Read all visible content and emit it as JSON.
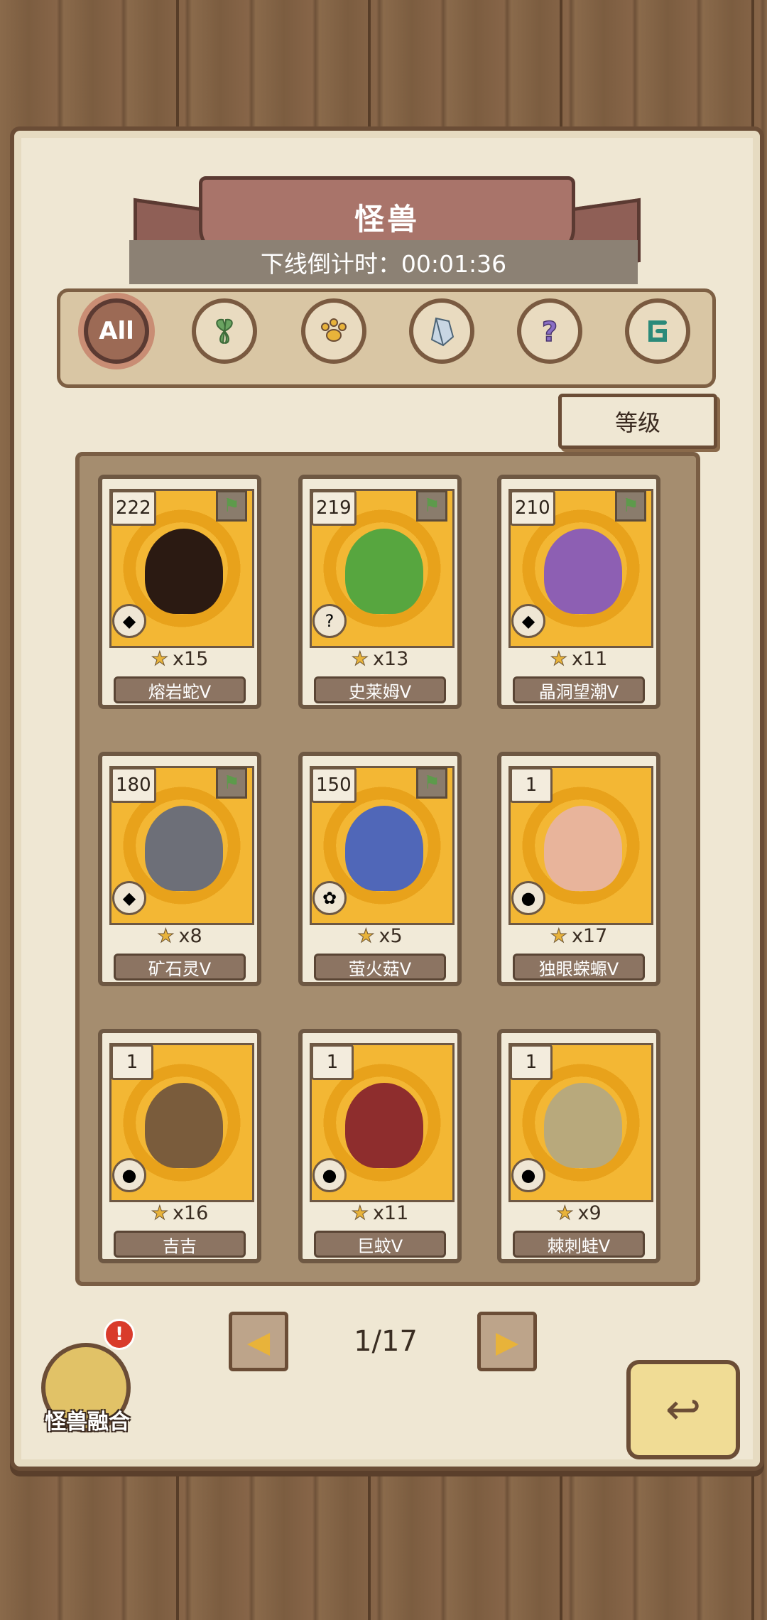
{
  "header": {
    "title": "怪兽",
    "timer_text": "下线倒计时：00:01:36"
  },
  "filters": [
    {
      "label": "All",
      "icon": "all-icon"
    },
    {
      "label": "",
      "icon": "leaf-icon"
    },
    {
      "label": "",
      "icon": "paw-icon"
    },
    {
      "label": "",
      "icon": "crystal-icon"
    },
    {
      "label": "",
      "icon": "question-icon"
    },
    {
      "label": "",
      "icon": "swirl-icon"
    }
  ],
  "sort": {
    "label": "等级"
  },
  "cards": [
    {
      "level": "222",
      "stars": "x15",
      "name": "熔岩蛇V",
      "element": "crystal-icon",
      "flag": true,
      "color": "#2b1a12"
    },
    {
      "level": "219",
      "stars": "x13",
      "name": "史莱姆V",
      "element": "question-icon",
      "flag": true,
      "color": "#57a63f"
    },
    {
      "level": "210",
      "stars": "x11",
      "name": "晶洞望潮V",
      "element": "crystal-icon",
      "flag": true,
      "color": "#8d5fb3"
    },
    {
      "level": "180",
      "stars": "x8",
      "name": "矿石灵V",
      "element": "crystal-icon",
      "flag": true,
      "color": "#6d6f78"
    },
    {
      "level": "150",
      "stars": "x5",
      "name": "萤火菇V",
      "element": "leaf-icon",
      "flag": true,
      "color": "#5067b8"
    },
    {
      "level": "1",
      "stars": "x17",
      "name": "独眼蝾螈V",
      "element": "paw-icon",
      "flag": false,
      "color": "#e8b49b"
    },
    {
      "level": "1",
      "stars": "x16",
      "name": "吉吉",
      "element": "paw-icon",
      "flag": false,
      "color": "#7a5c3c"
    },
    {
      "level": "1",
      "stars": "x11",
      "name": "巨蚊V",
      "element": "paw-icon",
      "flag": false,
      "color": "#8e2d2d"
    },
    {
      "level": "1",
      "stars": "x9",
      "name": "棘刺蛙V",
      "element": "paw-icon",
      "flag": false,
      "color": "#b8a97c"
    }
  ],
  "pager": {
    "current": "1/17"
  },
  "fusion": {
    "label": "怪兽融合",
    "badge": "!"
  }
}
